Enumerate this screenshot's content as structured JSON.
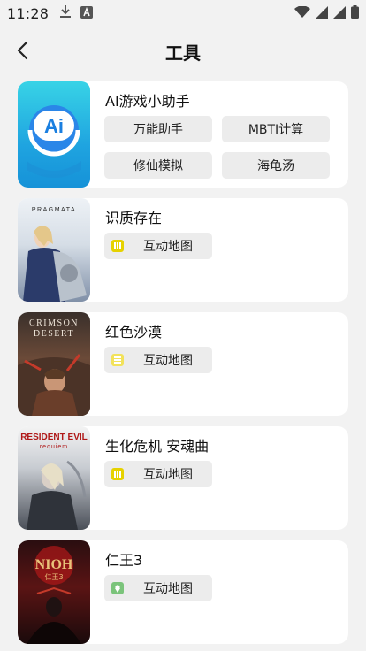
{
  "status": {
    "time": "11:28"
  },
  "header": {
    "title": "工具"
  },
  "cards": [
    {
      "title": "AI游戏小助手",
      "chips": [
        "万能助手",
        "MBTI计算",
        "修仙模拟",
        "海龟汤"
      ]
    },
    {
      "title": "识质存在",
      "cover_text": "PRAGMATA",
      "chip": "互动地图",
      "chip_icon_color": "#e6d200"
    },
    {
      "title": "红色沙漠",
      "cover_text_1": "CRIMSON",
      "cover_text_2": "DESERT",
      "chip": "互动地图",
      "chip_icon_color": "#f2e25a"
    },
    {
      "title": "生化危机 安魂曲",
      "cover_text_1": "RESIDENT EVIL",
      "cover_text_2": "requiem",
      "chip": "互动地图",
      "chip_icon_color": "#e6d200"
    },
    {
      "title": "仁王3",
      "cover_text_1": "NIOH",
      "cover_text_2": "仁王3",
      "chip": "互动地图",
      "chip_icon_color": "#7bc47b"
    }
  ]
}
